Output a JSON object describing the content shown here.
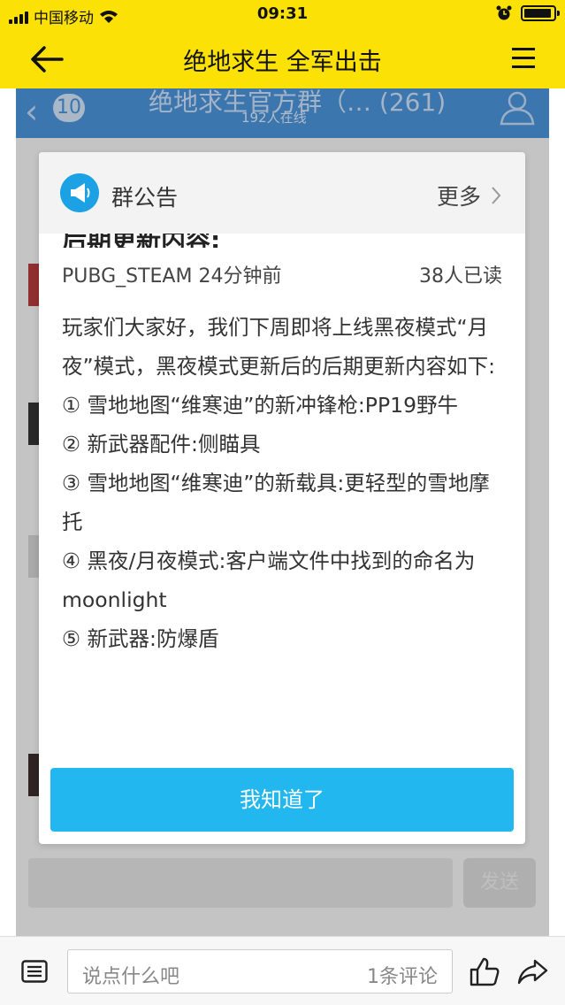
{
  "status_bar": {
    "carrier": "中国移动",
    "time": "09:31"
  },
  "nav": {
    "title": "绝地求生 全军出击"
  },
  "background_chat": {
    "unread_count": "10",
    "group_title": "绝地求生官方群（… (261)",
    "online_text": "192人在线",
    "send_label": "发送"
  },
  "announcement": {
    "title": "群公告",
    "more_label": "更多",
    "cut_heading": "后期更新内容:",
    "author_time": "PUBG_STEAM 24分钟前",
    "read_count": "38人已读",
    "body": [
      "玩家们大家好，我们下周即将上线黑夜模式“月夜”模式，黑夜模式更新后的后期更新内容如下:",
      "① 雪地地图“维寒迪”的新冲锋枪:PP19野牛",
      "② 新武器配件:侧瞄具",
      "③ 雪地地图“维寒迪”的新载具:更轻型的雪地摩托",
      "④ 黑夜/月夜模式:客户端文件中找到的命名为 moonlight",
      "⑤ 新武器:防爆盾"
    ],
    "confirm_button": "我知道了"
  },
  "comment_bar": {
    "placeholder": "说点什么吧",
    "comment_count": "1条评论"
  },
  "colors": {
    "header_yellow": "#fbe106",
    "chat_blue": "#4a90d6",
    "button_blue": "#22b7ee",
    "icon_blue": "#1ba1e4"
  }
}
